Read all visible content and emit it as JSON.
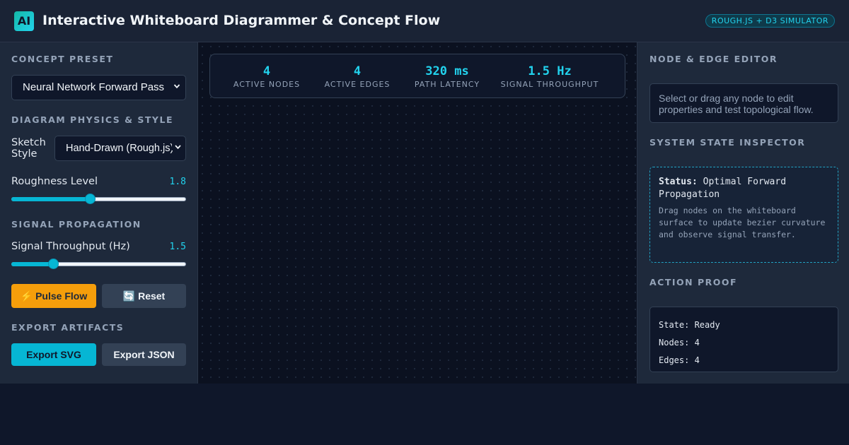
{
  "header": {
    "logo_text": "AI",
    "title": "Interactive Whiteboard Diagrammer & Concept Flow",
    "badge": "ROUGH.JS + D3 SIMULATOR"
  },
  "left_panel": {
    "concept_preset": {
      "title": "CONCEPT PRESET",
      "selected": "Neural Network Forward Pass"
    },
    "physics_style": {
      "title": "DIAGRAM PHYSICS & STYLE",
      "sketch_style_label": "Sketch Style",
      "sketch_style_value": "Hand-Drawn (Rough.js)",
      "roughness_label": "Roughness Level",
      "roughness_value": "1.8",
      "roughness_fraction": 0.45
    },
    "signal": {
      "title": "SIGNAL PROPAGATION",
      "throughput_label": "Signal Throughput (Hz)",
      "throughput_value": "1.5",
      "throughput_fraction": 0.24,
      "pulse_button": "⚡ Pulse Flow",
      "reset_button": "🔄 Reset"
    },
    "export": {
      "title": "EXPORT ARTIFACTS",
      "svg_button": "Export SVG",
      "json_button": "Export JSON"
    }
  },
  "stats": [
    {
      "value": "4",
      "label": "ACTIVE NODES"
    },
    {
      "value": "4",
      "label": "ACTIVE EDGES"
    },
    {
      "value": "320 ms",
      "label": "PATH LATENCY"
    },
    {
      "value": "1.5 Hz",
      "label": "SIGNAL THROUGHPUT"
    }
  ],
  "right_panel": {
    "editor_title": "NODE & EDGE EDITOR",
    "editor_hint": "Select or drag any node to edit properties and test topological flow.",
    "inspector_title": "SYSTEM STATE INSPECTOR",
    "status_label": "Status:",
    "status_value": "Optimal Forward Propagation",
    "inspector_desc": "Drag nodes on the whiteboard surface to update bezier curvature and observe signal transfer.",
    "proof_title": "ACTION PROOF",
    "proof_lines": [
      "State: Ready",
      "Nodes: 4",
      "Edges: 4"
    ]
  },
  "colors": {
    "accent": "#22d3ee",
    "pulse_button": "#f59e0b",
    "export_svg_button": "#06b6d4"
  }
}
